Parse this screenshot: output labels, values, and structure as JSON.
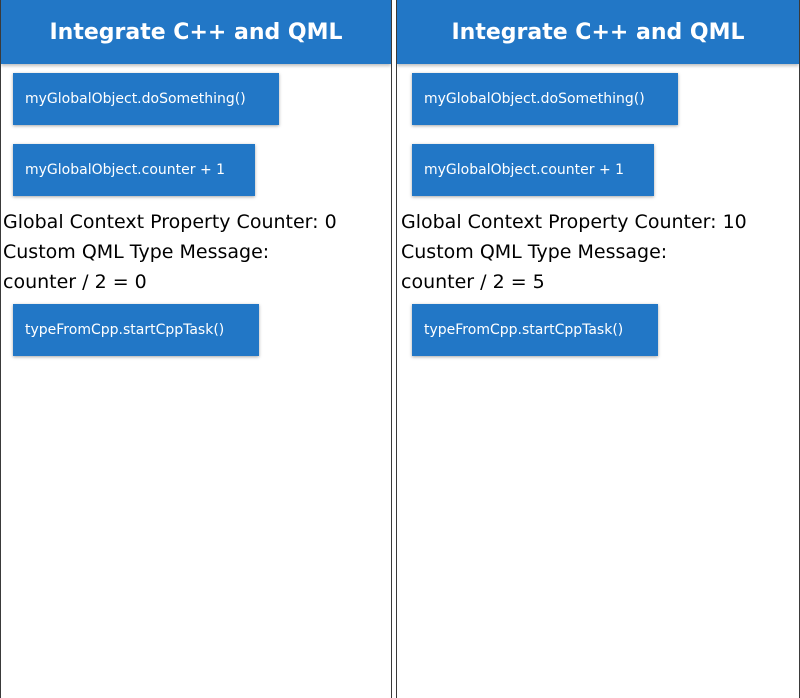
{
  "windows": [
    {
      "title": "Integrate C++ and QML",
      "buttons": {
        "do_something": "myGlobalObject.doSomething()",
        "counter_plus": "myGlobalObject.counter + 1",
        "start_task": "typeFromCpp.startCppTask()"
      },
      "labels": {
        "global_counter": "Global Context Property Counter: 0",
        "custom_message": "Custom QML Type Message:",
        "counter_half": "counter / 2 = 0"
      }
    },
    {
      "title": "Integrate C++ and QML",
      "buttons": {
        "do_something": "myGlobalObject.doSomething()",
        "counter_plus": "myGlobalObject.counter + 1",
        "start_task": "typeFromCpp.startCppTask()"
      },
      "labels": {
        "global_counter": "Global Context Property Counter: 10",
        "custom_message": "Custom QML Type Message:",
        "counter_half": "counter / 2 = 5"
      }
    }
  ],
  "colors": {
    "accent": "#2277c6",
    "text": "#000000",
    "button_text": "#ffffff"
  }
}
